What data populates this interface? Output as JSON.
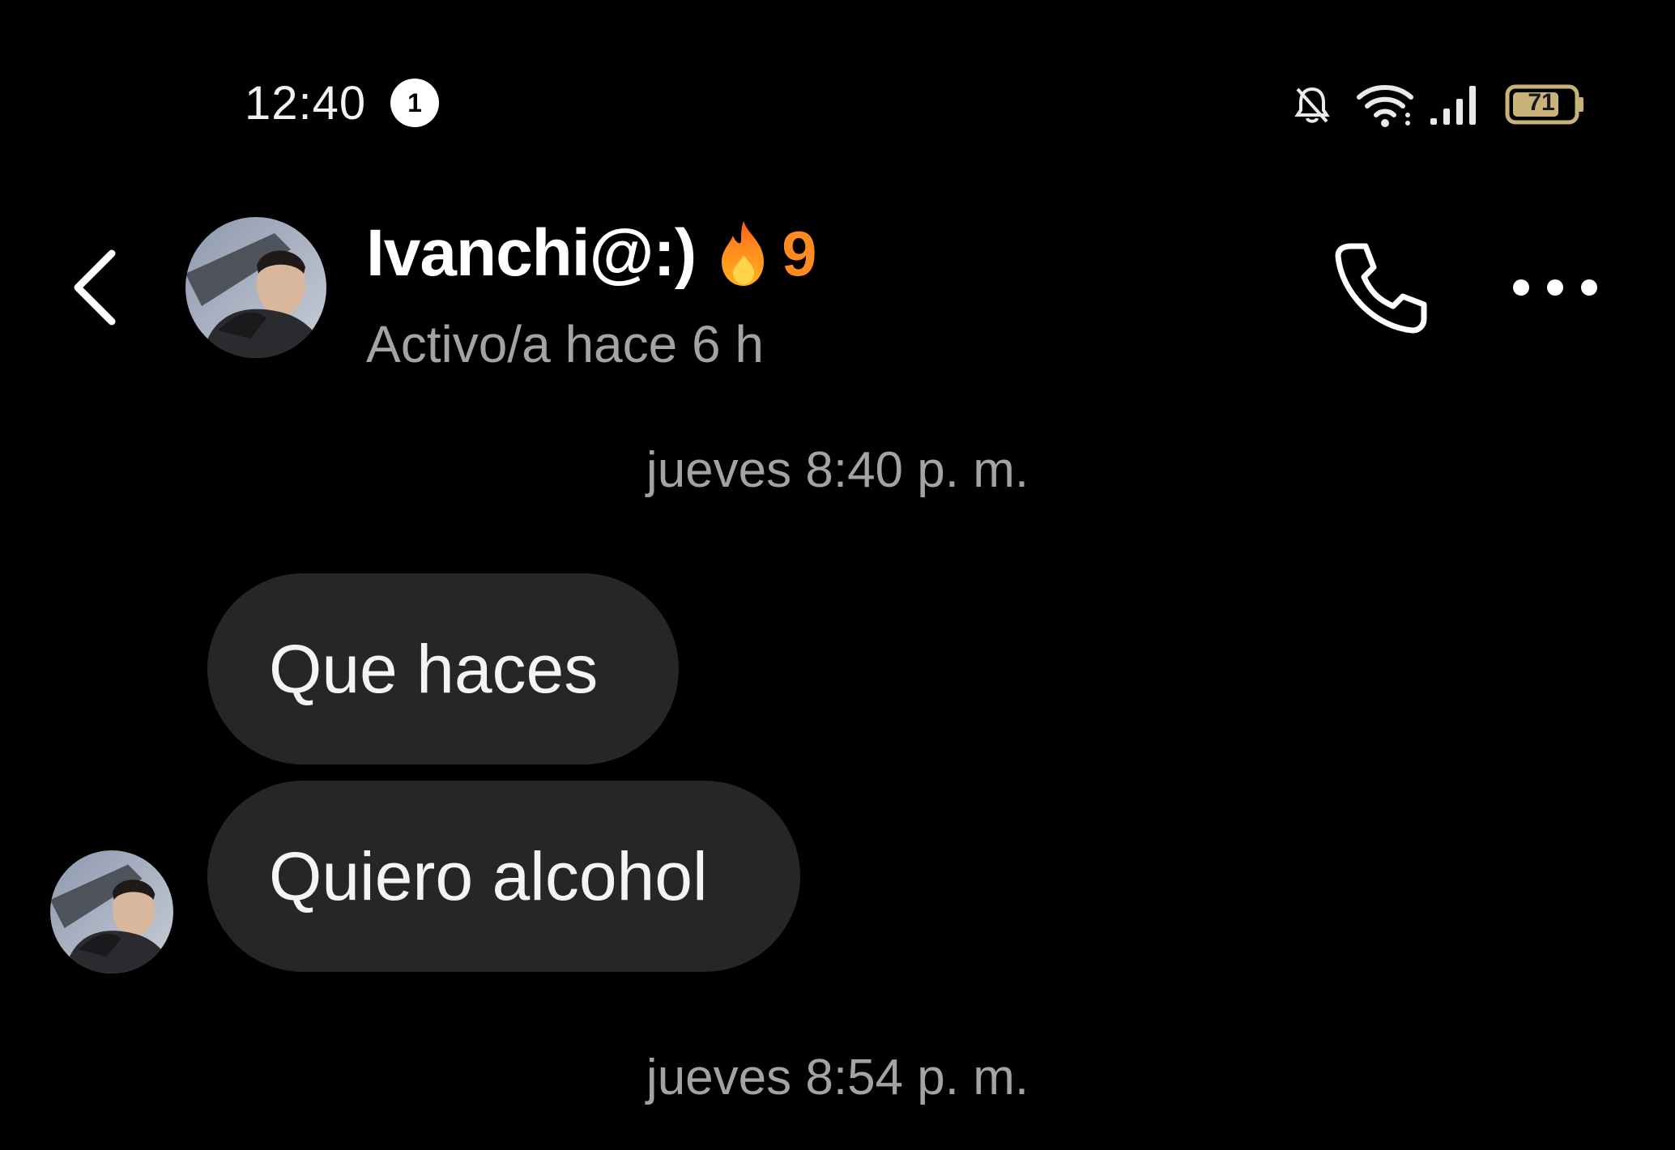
{
  "status_bar": {
    "time": "12:40",
    "notification_count": "1",
    "battery_level": "71",
    "icons": [
      "bell-muted-icon",
      "wifi-icon",
      "signal-icon",
      "battery-icon"
    ]
  },
  "header": {
    "contact_name": "Ivanchi@:)",
    "streak_icon": "fire-icon",
    "streak_count": "9",
    "status": "Activo/a hace 6 h",
    "actions": [
      "back-icon",
      "phone-icon",
      "more-icon"
    ]
  },
  "conversation": {
    "timestamps": [
      "jueves 8:40 p. m.",
      "jueves 8:54 p. m."
    ],
    "messages": [
      {
        "text": "Que haces"
      },
      {
        "text": "Quiero alcohol"
      }
    ]
  },
  "colors": {
    "background": "#000000",
    "bubble": "#262626",
    "streak": "#ff8a1f",
    "muted_text": "#a3a3a3"
  }
}
